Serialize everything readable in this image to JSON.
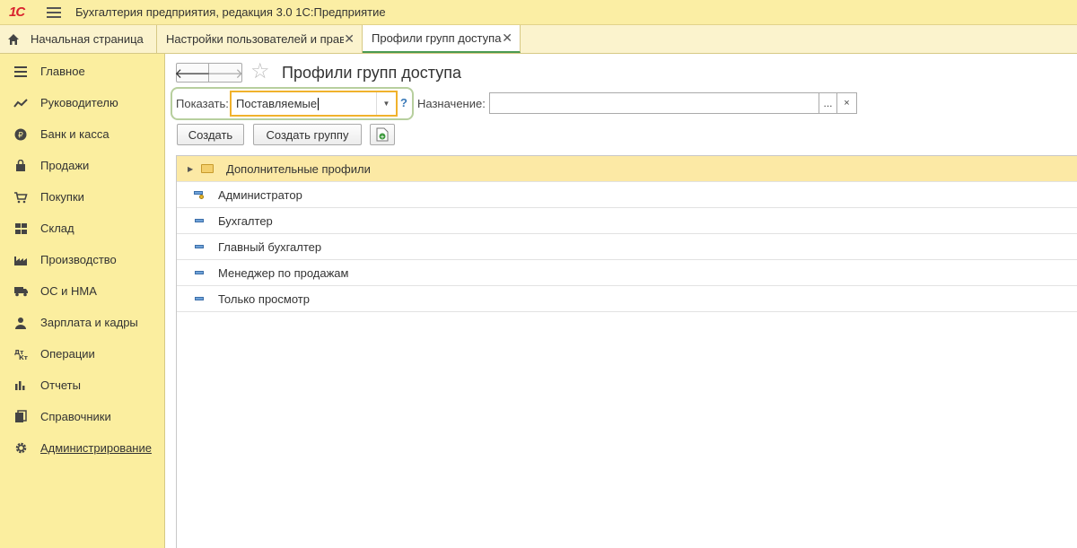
{
  "window": {
    "title": "Бухгалтерия предприятия, редакция 3.0 1С:Предприятие",
    "logo": "1С"
  },
  "tabs": [
    {
      "label": "Начальная страница",
      "icon": "home-icon"
    },
    {
      "label": "Настройки пользователей и прав",
      "close": "✕"
    },
    {
      "label": "Профили групп доступа",
      "close": "✕",
      "active": true
    }
  ],
  "sidebar": {
    "items": [
      {
        "label": "Главное",
        "icon": "menu-lines-icon"
      },
      {
        "label": "Руководителю",
        "icon": "trend-chart-icon"
      },
      {
        "label": "Банк и касса",
        "icon": "ruble-coin-icon"
      },
      {
        "label": "Продажи",
        "icon": "shopping-bag-icon"
      },
      {
        "label": "Покупки",
        "icon": "shopping-cart-icon"
      },
      {
        "label": "Склад",
        "icon": "warehouse-grid-icon"
      },
      {
        "label": "Производство",
        "icon": "factory-icon"
      },
      {
        "label": "ОС и НМА",
        "icon": "truck-icon"
      },
      {
        "label": "Зарплата и кадры",
        "icon": "person-icon"
      },
      {
        "label": "Операции",
        "icon": "debit-credit-icon"
      },
      {
        "label": "Отчеты",
        "icon": "bar-chart-icon"
      },
      {
        "label": "Справочники",
        "icon": "books-icon"
      },
      {
        "label": "Администрирование",
        "icon": "gear-icon",
        "active": true
      }
    ]
  },
  "page": {
    "title": "Профили групп доступа",
    "nav_back": "🡐",
    "nav_forward": "🡒"
  },
  "filters": {
    "show_label": "Показать:",
    "show_value": "Поставляемые",
    "help": "?",
    "purpose_label": "Назначение:",
    "purpose_value": "",
    "purpose_dots": "...",
    "purpose_clear": "×"
  },
  "toolbar": {
    "create_label": "Создать",
    "create_group_label": "Создать группу"
  },
  "list": {
    "rows": [
      {
        "label": "Дополнительные профили",
        "type": "folder",
        "selected": true
      },
      {
        "label": "Администратор",
        "type": "profile-admin"
      },
      {
        "label": "Бухгалтер",
        "type": "profile"
      },
      {
        "label": "Главный бухгалтер",
        "type": "profile"
      },
      {
        "label": "Менеджер по продажам",
        "type": "profile"
      },
      {
        "label": "Только просмотр",
        "type": "profile"
      }
    ]
  },
  "colors": {
    "titlebar_bg": "#fbeea4",
    "sidebar_bg": "#fbee9f",
    "selected_row": "#fce9a5",
    "active_tab_accent": "#4a9a52",
    "input_focus_border": "#f0b22c"
  }
}
